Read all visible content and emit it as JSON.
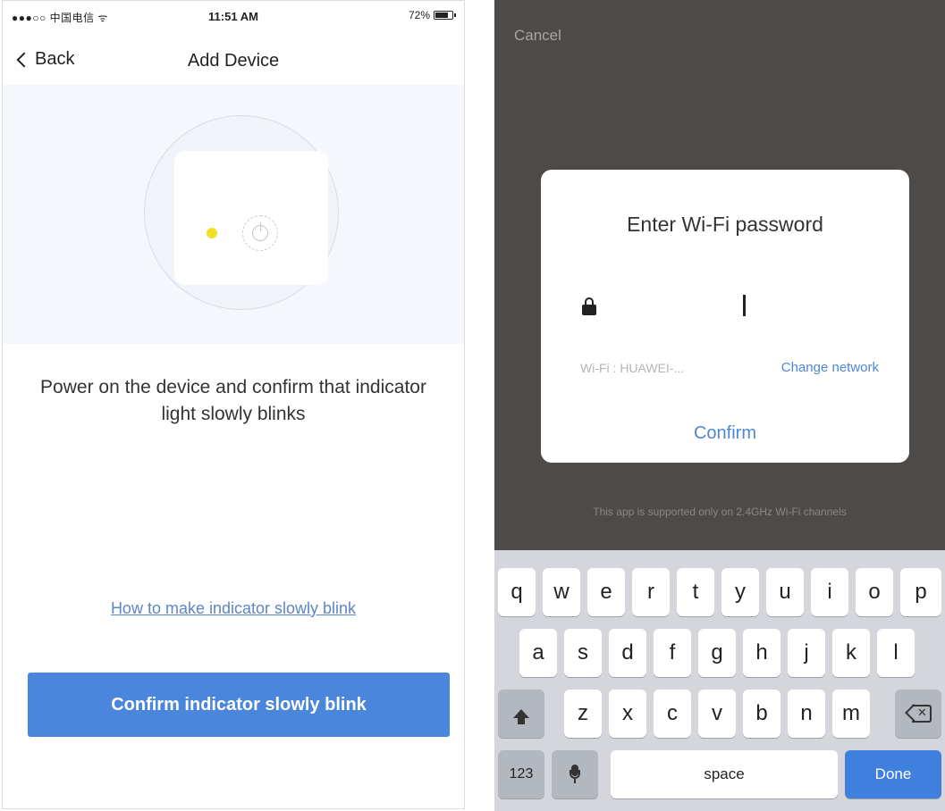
{
  "left_screen": {
    "status_bar": {
      "carrier": "●●●○○ 中国电信 ᯤ",
      "time": "11:51 AM",
      "battery_text": "72%"
    },
    "nav": {
      "back_label": "Back",
      "title": "Add Device"
    },
    "instruction": "Power on the device and confirm that indicator light slowly blinks",
    "help_link": "How to make indicator slowly blink",
    "primary_button": "Confirm indicator slowly blink",
    "colors": {
      "accent": "#4b86dd",
      "indicator": "#f2e025",
      "link": "#5b86c9"
    }
  },
  "right_screen": {
    "cancel_label": "Cancel",
    "dialog": {
      "title": "Enter Wi-Fi password",
      "password_value": "",
      "wifi_label": "Wi-Fi : HUAWEI-...",
      "change_network_label": "Change network",
      "confirm_label": "Confirm"
    },
    "support_note": "This app is supported only on 2.4GHz Wi-Fi channels",
    "keyboard": {
      "row1": [
        "q",
        "w",
        "e",
        "r",
        "t",
        "y",
        "u",
        "i",
        "o",
        "p"
      ],
      "row2": [
        "a",
        "s",
        "d",
        "f",
        "g",
        "h",
        "j",
        "k",
        "l"
      ],
      "row3": [
        "z",
        "x",
        "c",
        "v",
        "b",
        "n",
        "m"
      ],
      "numbers_key": "123",
      "space_key": "space",
      "done_key": "Done"
    },
    "colors": {
      "accent": "#4f86d6",
      "done_key": "#3f7fdd",
      "backdrop": "#4e4a48"
    }
  }
}
